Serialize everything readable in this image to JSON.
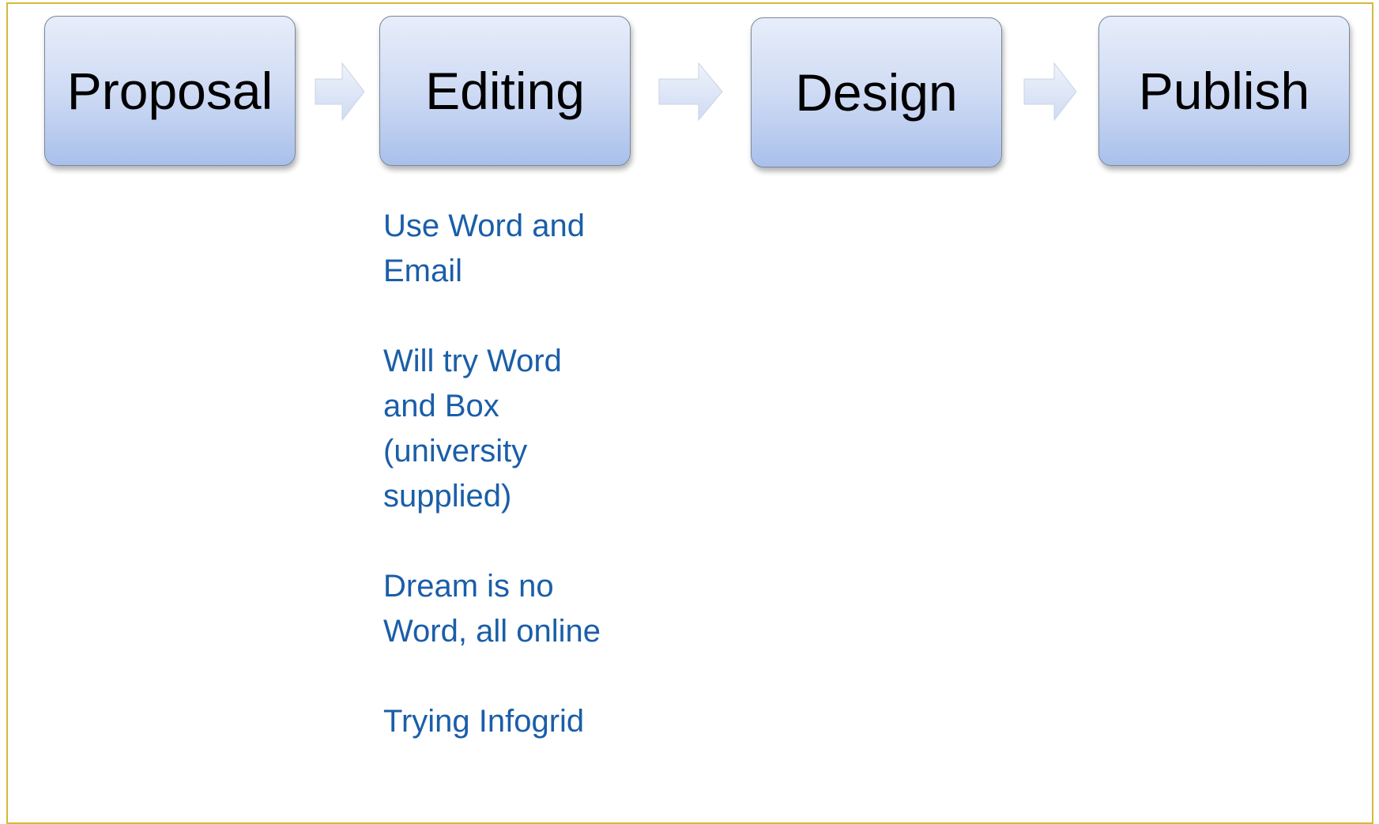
{
  "stages": [
    {
      "label": "Proposal"
    },
    {
      "label": "Editing"
    },
    {
      "label": "Design"
    },
    {
      "label": "Publish"
    }
  ],
  "notes": {
    "items": [
      {
        "lines": [
          "Use Word and",
          "Email"
        ]
      },
      {
        "lines": [
          "Will try Word",
          "and Box",
          "(university",
          "supplied)"
        ]
      },
      {
        "lines": [
          "Dream is no",
          "Word, all online"
        ]
      },
      {
        "lines": [
          "Trying Infogrid"
        ]
      }
    ]
  },
  "colors": {
    "frame_border": "#d6b93a",
    "box_top": "#e7edfa",
    "box_bottom": "#a9c0ec",
    "arrow_fill": "#dde6f6",
    "note_text": "#1a5ea8"
  },
  "icons": [
    "right-arrow-icon"
  ]
}
